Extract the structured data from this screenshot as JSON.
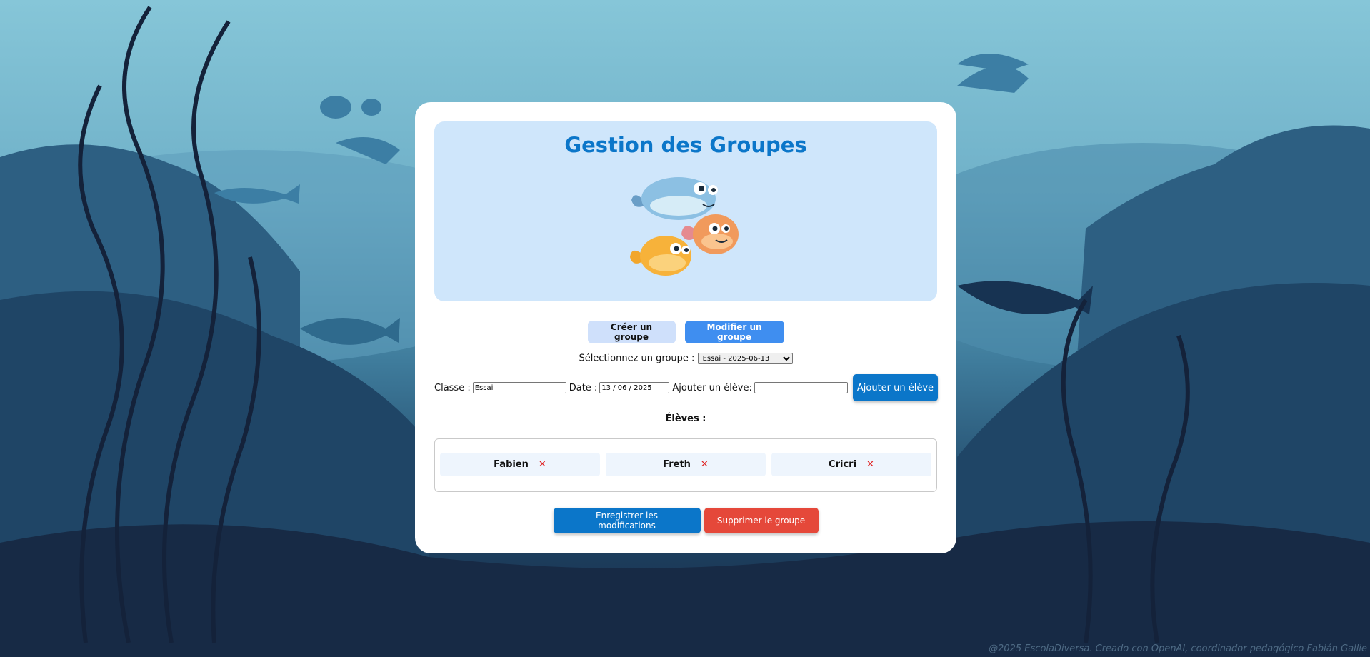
{
  "header": {
    "title": "Gestion des Groupes"
  },
  "tabs": {
    "create": "Créer un groupe",
    "modify": "Modifier un groupe"
  },
  "select_group": {
    "label": "Sélectionnez un groupe :",
    "selected": "Essai - 2025-06-13"
  },
  "form": {
    "classe_label": "Classe :",
    "classe_value": "Essai",
    "date_label": "Date :",
    "date_value": "13 / 06 / 2025",
    "add_student_label": "Ajouter un élève:",
    "add_student_value": "",
    "add_button": "Ajouter un élève"
  },
  "students": {
    "heading": "Élèves :",
    "list": [
      {
        "name": "Fabien",
        "remove": "✕"
      },
      {
        "name": "Freth",
        "remove": "✕"
      },
      {
        "name": "Cricri",
        "remove": "✕"
      }
    ]
  },
  "actions": {
    "save": "Enregistrer les modifications",
    "delete": "Supprimer le groupe"
  },
  "footer": "@2025 EscolaDiversa. Creado con OpenAI, coordinador pedagógico Fabián Gallie",
  "colors": {
    "primary": "#0b76c9",
    "danger": "#e5483a",
    "banner": "#cfe6fb",
    "accent": "#3f8ef0"
  }
}
